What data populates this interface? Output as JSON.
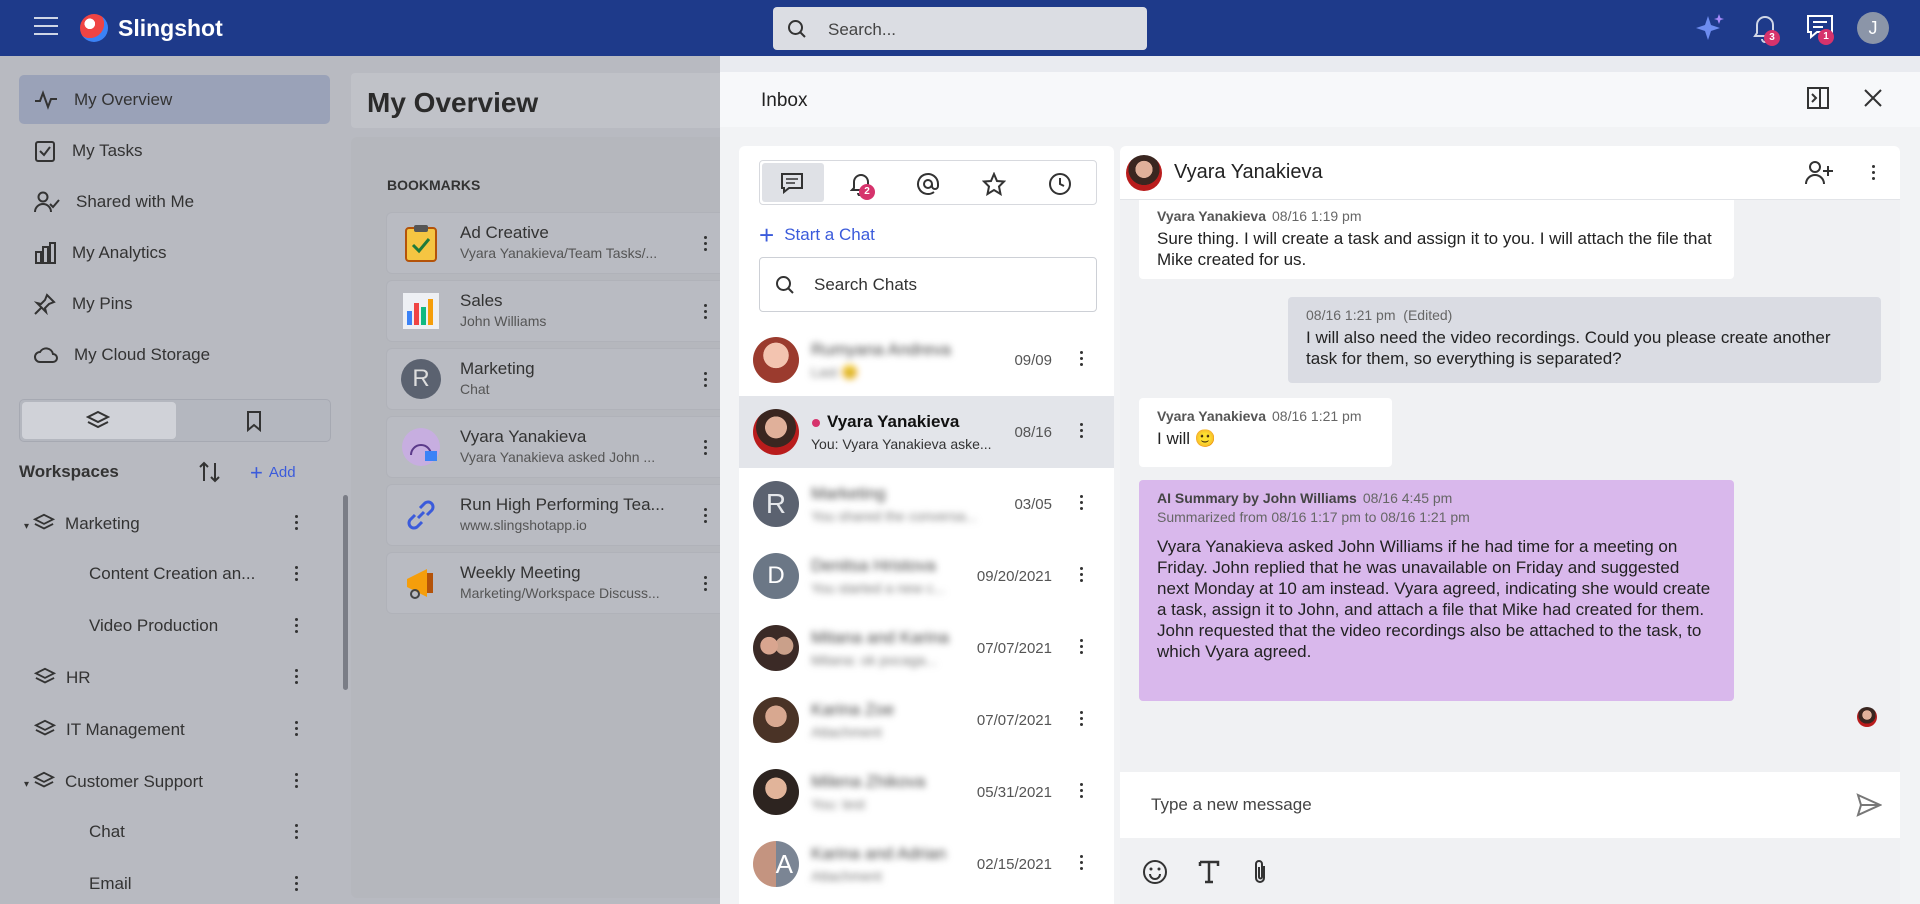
{
  "app": {
    "name": "Slingshot",
    "search_placeholder": "Search...",
    "user_initial": "J",
    "notif_count": "3",
    "msg_count": "1"
  },
  "sidebar": {
    "items": [
      {
        "label": "My Overview",
        "icon": "activity-icon"
      },
      {
        "label": "My Tasks",
        "icon": "task-icon"
      },
      {
        "label": "Shared with Me",
        "icon": "shared-user-icon"
      },
      {
        "label": "My Analytics",
        "icon": "analytics-icon"
      },
      {
        "label": "My Pins",
        "icon": "pin-icon"
      },
      {
        "label": "My Cloud Storage",
        "icon": "cloud-icon"
      }
    ],
    "workspaces_title": "Workspaces",
    "add_label": "Add",
    "tree": [
      {
        "label": "Marketing",
        "level": 0
      },
      {
        "label": "Content Creation an...",
        "level": 1
      },
      {
        "label": "Video Production",
        "level": 1
      },
      {
        "label": "HR",
        "level": 0
      },
      {
        "label": "IT Management",
        "level": 0
      },
      {
        "label": "Customer Support",
        "level": 0
      },
      {
        "label": "Chat",
        "level": 1
      },
      {
        "label": "Email",
        "level": 1
      }
    ]
  },
  "main": {
    "title": "My Overview",
    "bookmarks_title": "BOOKMARKS",
    "bookmarks": [
      {
        "title": "Ad Creative",
        "subtitle": "Vyara Yanakieva/Team Tasks/..."
      },
      {
        "title": "Sales",
        "subtitle": "John Williams"
      },
      {
        "title": "Marketing",
        "subtitle": "Chat"
      },
      {
        "title": "Vyara Yanakieva",
        "subtitle": "Vyara Yanakieva asked John ..."
      },
      {
        "title": "Run High Performing Tea...",
        "subtitle": "www.slingshotapp.io"
      },
      {
        "title": "Weekly Meeting",
        "subtitle": "Marketing/Workspace Discuss..."
      }
    ]
  },
  "inbox": {
    "title": "Inbox",
    "mention_badge": "2",
    "start_chat": "Start a Chat",
    "search_placeholder": "Search Chats",
    "chats": [
      {
        "name": "Rumyana Andreva",
        "preview": "Last 😊",
        "date": "09/09"
      },
      {
        "name": "Vyara Yanakieva",
        "preview": "You: Vyara Yanakieva aske...",
        "date": "08/16"
      },
      {
        "name": "Marketing",
        "preview": "You shared the conversa...",
        "date": "03/05"
      },
      {
        "name": "Denitsa Hristova",
        "preview": "You started a new c...",
        "date": "09/20/2021"
      },
      {
        "name": "Mitana and Karina",
        "preview": "Mitana: ok pocaga...",
        "date": "07/07/2021"
      },
      {
        "name": "Karina Zoe",
        "preview": "Attachment",
        "date": "07/07/2021"
      },
      {
        "name": "Milena Zhikova",
        "preview": "You: test",
        "date": "05/31/2021"
      },
      {
        "name": "Karina and Adrian",
        "preview": "Attachment",
        "date": "02/15/2021"
      }
    ],
    "conversation": {
      "name": "Vyara Yanakieva",
      "messages": [
        {
          "author": "Vyara Yanakieva",
          "time": "08/16 1:19 pm",
          "text": "Sure thing. I will create a task and assign it to you. I will attach the file that Mike created for us."
        },
        {
          "author": "",
          "time": "08/16 1:21 pm",
          "edited": "(Edited)",
          "text": "I will also need the video recordings. Could you please create another task for them, so everything is separated?"
        },
        {
          "author": "Vyara Yanakieva",
          "time": "08/16 1:21 pm",
          "text": "I will 🙂"
        },
        {
          "author": "AI Summary by John Williams",
          "time": "08/16 4:45 pm",
          "range": "Summarized from 08/16 1:17 pm to 08/16 1:21 pm",
          "text": "Vyara Yanakieva asked John Williams if he had time for a meeting on Friday. John replied that he was unavailable on Friday and suggested next Monday at 10 am instead. Vyara agreed, indicating she would create a task, assign it to John, and attach a file that Mike had created for them. John requested that the video recordings also be attached to the task, to which Vyara agreed."
        }
      ],
      "compose_placeholder": "Type a new message"
    }
  },
  "colors": {
    "topbar": "#1e3a8a",
    "accent": "#3b5bdb",
    "badge": "#d6336c",
    "ai_bubble": "#d9b8ec"
  }
}
